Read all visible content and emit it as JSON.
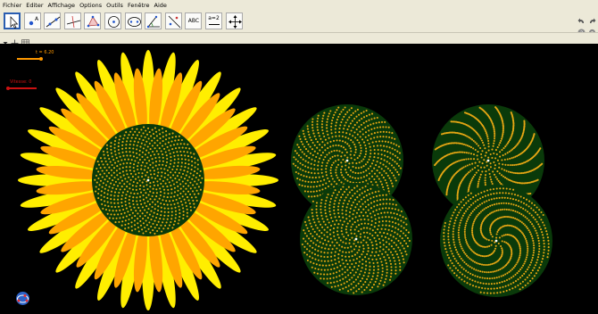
{
  "menu": [
    "Fichier",
    "Editer",
    "Affichage",
    "Options",
    "Outils",
    "Fenêtre",
    "Aide"
  ],
  "toolbar": {
    "tools": [
      {
        "name": "move-tool",
        "icon": "cursor-arrow-icon",
        "active": true
      },
      {
        "name": "point-tool",
        "icon": "point-a-icon"
      },
      {
        "name": "line-tool",
        "icon": "line-through-points-icon"
      },
      {
        "name": "perpendicular-tool",
        "icon": "perpendicular-line-icon"
      },
      {
        "name": "polygon-tool",
        "icon": "polygon-icon"
      },
      {
        "name": "circle-tool",
        "icon": "circle-center-point-icon"
      },
      {
        "name": "ellipse-tool",
        "icon": "ellipse-icon"
      },
      {
        "name": "angle-tool",
        "icon": "angle-icon"
      },
      {
        "name": "reflect-tool",
        "icon": "reflect-about-line-icon"
      },
      {
        "name": "text-tool",
        "icon": "text-abc-icon",
        "label": "ABC"
      },
      {
        "name": "slider-tool",
        "icon": "slider-icon",
        "label": "a=2"
      },
      {
        "name": "move-view-tool",
        "icon": "move-graphics-view-icon"
      }
    ]
  },
  "canvas": {
    "slider_t": {
      "label": "t = 6.20",
      "value": 6.2,
      "color": "#ff9900"
    },
    "slider_speed": {
      "label": "Vitesse: 0",
      "value": 0,
      "color": "#cc1111"
    },
    "colors": {
      "background": "#000000",
      "seed": "#e6a614",
      "disk": "#0a3a0a",
      "petal_outer": "#ffee00",
      "petal_inner": "#ffa500"
    }
  }
}
